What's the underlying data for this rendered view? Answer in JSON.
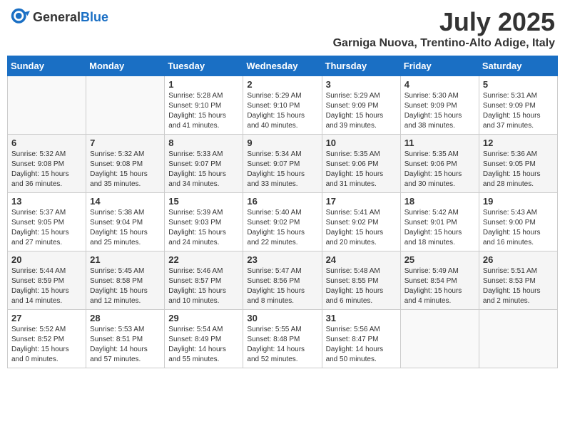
{
  "header": {
    "logo_general": "General",
    "logo_blue": "Blue",
    "title": "July 2025",
    "subtitle": "Garniga Nuova, Trentino-Alto Adige, Italy"
  },
  "weekdays": [
    "Sunday",
    "Monday",
    "Tuesday",
    "Wednesday",
    "Thursday",
    "Friday",
    "Saturday"
  ],
  "weeks": [
    [
      {
        "day": "",
        "sunrise": "",
        "sunset": "",
        "daylight": ""
      },
      {
        "day": "",
        "sunrise": "",
        "sunset": "",
        "daylight": ""
      },
      {
        "day": "1",
        "sunrise": "Sunrise: 5:28 AM",
        "sunset": "Sunset: 9:10 PM",
        "daylight": "Daylight: 15 hours and 41 minutes."
      },
      {
        "day": "2",
        "sunrise": "Sunrise: 5:29 AM",
        "sunset": "Sunset: 9:10 PM",
        "daylight": "Daylight: 15 hours and 40 minutes."
      },
      {
        "day": "3",
        "sunrise": "Sunrise: 5:29 AM",
        "sunset": "Sunset: 9:09 PM",
        "daylight": "Daylight: 15 hours and 39 minutes."
      },
      {
        "day": "4",
        "sunrise": "Sunrise: 5:30 AM",
        "sunset": "Sunset: 9:09 PM",
        "daylight": "Daylight: 15 hours and 38 minutes."
      },
      {
        "day": "5",
        "sunrise": "Sunrise: 5:31 AM",
        "sunset": "Sunset: 9:09 PM",
        "daylight": "Daylight: 15 hours and 37 minutes."
      }
    ],
    [
      {
        "day": "6",
        "sunrise": "Sunrise: 5:32 AM",
        "sunset": "Sunset: 9:08 PM",
        "daylight": "Daylight: 15 hours and 36 minutes."
      },
      {
        "day": "7",
        "sunrise": "Sunrise: 5:32 AM",
        "sunset": "Sunset: 9:08 PM",
        "daylight": "Daylight: 15 hours and 35 minutes."
      },
      {
        "day": "8",
        "sunrise": "Sunrise: 5:33 AM",
        "sunset": "Sunset: 9:07 PM",
        "daylight": "Daylight: 15 hours and 34 minutes."
      },
      {
        "day": "9",
        "sunrise": "Sunrise: 5:34 AM",
        "sunset": "Sunset: 9:07 PM",
        "daylight": "Daylight: 15 hours and 33 minutes."
      },
      {
        "day": "10",
        "sunrise": "Sunrise: 5:35 AM",
        "sunset": "Sunset: 9:06 PM",
        "daylight": "Daylight: 15 hours and 31 minutes."
      },
      {
        "day": "11",
        "sunrise": "Sunrise: 5:35 AM",
        "sunset": "Sunset: 9:06 PM",
        "daylight": "Daylight: 15 hours and 30 minutes."
      },
      {
        "day": "12",
        "sunrise": "Sunrise: 5:36 AM",
        "sunset": "Sunset: 9:05 PM",
        "daylight": "Daylight: 15 hours and 28 minutes."
      }
    ],
    [
      {
        "day": "13",
        "sunrise": "Sunrise: 5:37 AM",
        "sunset": "Sunset: 9:05 PM",
        "daylight": "Daylight: 15 hours and 27 minutes."
      },
      {
        "day": "14",
        "sunrise": "Sunrise: 5:38 AM",
        "sunset": "Sunset: 9:04 PM",
        "daylight": "Daylight: 15 hours and 25 minutes."
      },
      {
        "day": "15",
        "sunrise": "Sunrise: 5:39 AM",
        "sunset": "Sunset: 9:03 PM",
        "daylight": "Daylight: 15 hours and 24 minutes."
      },
      {
        "day": "16",
        "sunrise": "Sunrise: 5:40 AM",
        "sunset": "Sunset: 9:02 PM",
        "daylight": "Daylight: 15 hours and 22 minutes."
      },
      {
        "day": "17",
        "sunrise": "Sunrise: 5:41 AM",
        "sunset": "Sunset: 9:02 PM",
        "daylight": "Daylight: 15 hours and 20 minutes."
      },
      {
        "day": "18",
        "sunrise": "Sunrise: 5:42 AM",
        "sunset": "Sunset: 9:01 PM",
        "daylight": "Daylight: 15 hours and 18 minutes."
      },
      {
        "day": "19",
        "sunrise": "Sunrise: 5:43 AM",
        "sunset": "Sunset: 9:00 PM",
        "daylight": "Daylight: 15 hours and 16 minutes."
      }
    ],
    [
      {
        "day": "20",
        "sunrise": "Sunrise: 5:44 AM",
        "sunset": "Sunset: 8:59 PM",
        "daylight": "Daylight: 15 hours and 14 minutes."
      },
      {
        "day": "21",
        "sunrise": "Sunrise: 5:45 AM",
        "sunset": "Sunset: 8:58 PM",
        "daylight": "Daylight: 15 hours and 12 minutes."
      },
      {
        "day": "22",
        "sunrise": "Sunrise: 5:46 AM",
        "sunset": "Sunset: 8:57 PM",
        "daylight": "Daylight: 15 hours and 10 minutes."
      },
      {
        "day": "23",
        "sunrise": "Sunrise: 5:47 AM",
        "sunset": "Sunset: 8:56 PM",
        "daylight": "Daylight: 15 hours and 8 minutes."
      },
      {
        "day": "24",
        "sunrise": "Sunrise: 5:48 AM",
        "sunset": "Sunset: 8:55 PM",
        "daylight": "Daylight: 15 hours and 6 minutes."
      },
      {
        "day": "25",
        "sunrise": "Sunrise: 5:49 AM",
        "sunset": "Sunset: 8:54 PM",
        "daylight": "Daylight: 15 hours and 4 minutes."
      },
      {
        "day": "26",
        "sunrise": "Sunrise: 5:51 AM",
        "sunset": "Sunset: 8:53 PM",
        "daylight": "Daylight: 15 hours and 2 minutes."
      }
    ],
    [
      {
        "day": "27",
        "sunrise": "Sunrise: 5:52 AM",
        "sunset": "Sunset: 8:52 PM",
        "daylight": "Daylight: 15 hours and 0 minutes."
      },
      {
        "day": "28",
        "sunrise": "Sunrise: 5:53 AM",
        "sunset": "Sunset: 8:51 PM",
        "daylight": "Daylight: 14 hours and 57 minutes."
      },
      {
        "day": "29",
        "sunrise": "Sunrise: 5:54 AM",
        "sunset": "Sunset: 8:49 PM",
        "daylight": "Daylight: 14 hours and 55 minutes."
      },
      {
        "day": "30",
        "sunrise": "Sunrise: 5:55 AM",
        "sunset": "Sunset: 8:48 PM",
        "daylight": "Daylight: 14 hours and 52 minutes."
      },
      {
        "day": "31",
        "sunrise": "Sunrise: 5:56 AM",
        "sunset": "Sunset: 8:47 PM",
        "daylight": "Daylight: 14 hours and 50 minutes."
      },
      {
        "day": "",
        "sunrise": "",
        "sunset": "",
        "daylight": ""
      },
      {
        "day": "",
        "sunrise": "",
        "sunset": "",
        "daylight": ""
      }
    ]
  ]
}
